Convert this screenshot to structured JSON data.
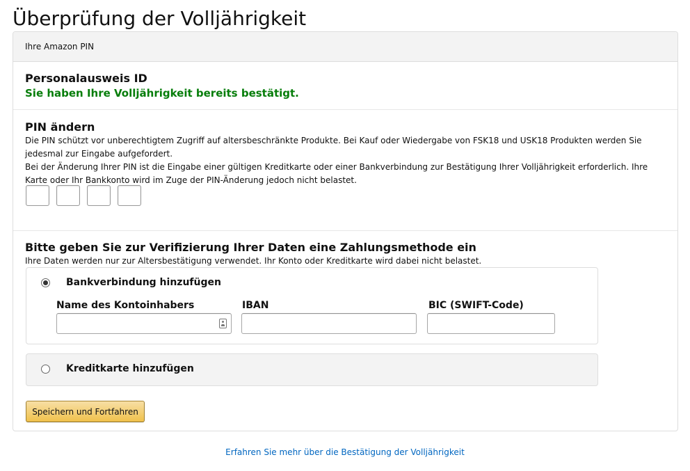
{
  "page": {
    "title": "Überprüfung der Volljährigkeit"
  },
  "card": {
    "header": "Ihre Amazon PIN",
    "id_section": {
      "title": "Personalausweis ID",
      "status": "Sie haben Ihre Volljährigkeit bereits bestätigt."
    },
    "pin_section": {
      "title": "PIN ändern",
      "description_1": "Die PIN schützt vor unberechtigtem Zugriff auf altersbeschränkte Produkte. Bei Kauf oder Wiedergabe von FSK18 und USK18 Produkten werden Sie jedesmal zur Eingabe aufgefordert.",
      "description_2": "Bei der Änderung Ihrer PIN ist die Eingabe einer gültigen Kreditkarte oder einer Bankverbindung zur Bestätigung Ihrer Volljährigkeit erforderlich. Ihre Karte oder Ihr Bankkonto wird im Zuge der PIN-Änderung jedoch nicht belastet.",
      "digits": [
        "",
        "",
        "",
        ""
      ]
    },
    "payment_section": {
      "title": "Bitte geben Sie zur Verifizierung Ihrer Daten eine Zahlungsmethode ein",
      "subtitle": "Ihre Daten werden nur zur Altersbestätigung verwendet. Ihr Konto oder Kreditkarte wird dabei nicht belastet.",
      "bank_option": {
        "label": "Bankverbindung hinzufügen",
        "selected": true,
        "fields": {
          "account_holder": {
            "label": "Name des Kontoinhabers",
            "value": ""
          },
          "iban": {
            "label": "IBAN",
            "value": ""
          },
          "bic": {
            "label": "BIC (SWIFT-Code)",
            "value": ""
          }
        }
      },
      "card_option": {
        "label": "Kreditkarte hinzufügen",
        "selected": false
      },
      "save_button": "Speichern und Fortfahren"
    }
  },
  "footer": {
    "learn_more_link": "Erfahren Sie mehr über die Bestätigung der Volljährigkeit"
  },
  "colors": {
    "success_text": "#067d0a",
    "link": "#0066c0",
    "button_gradient_top": "#f7dfa5",
    "button_gradient_bottom": "#f0c14b",
    "header_bg": "#f3f3f3"
  }
}
